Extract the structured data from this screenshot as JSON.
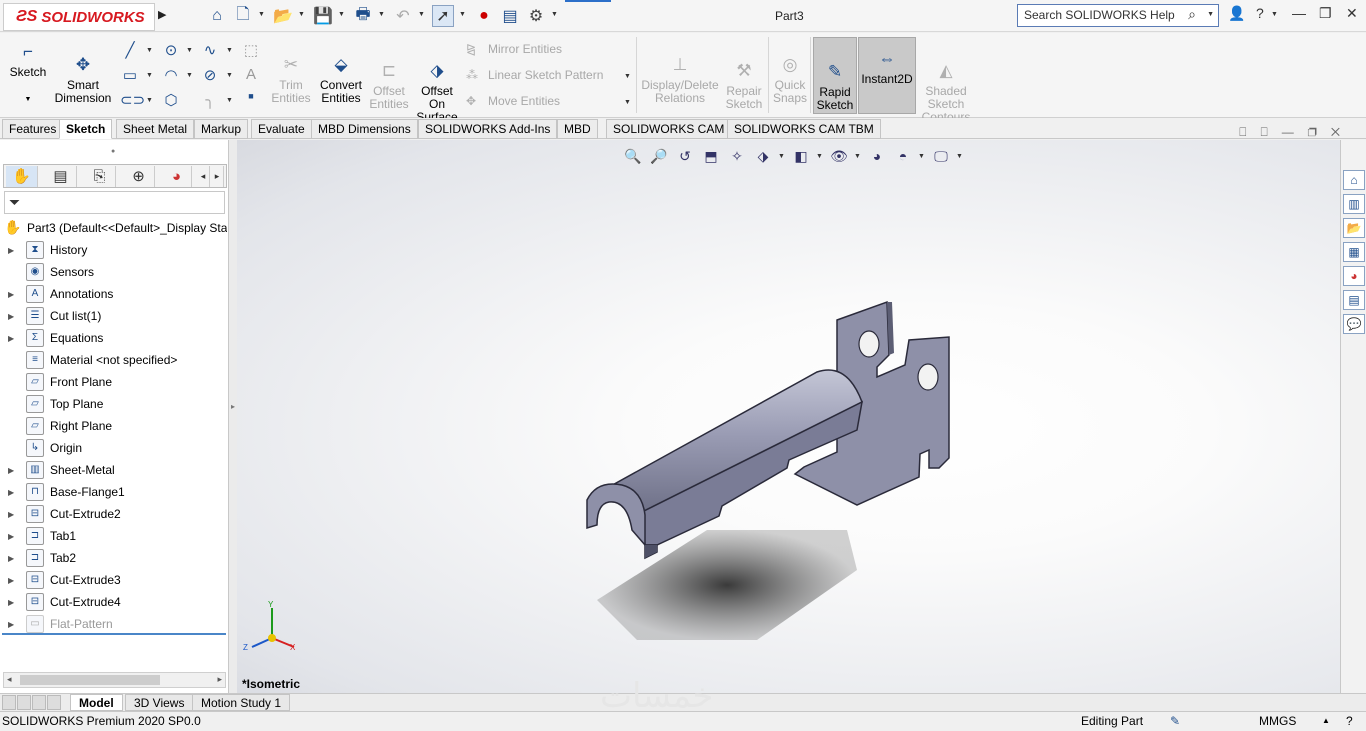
{
  "app": {
    "brand": "SOLIDWORKS",
    "document_title": "Part3",
    "search_placeholder": "Search SOLIDWORKS Help"
  },
  "quick_access": [
    {
      "name": "home-icon"
    },
    {
      "name": "new-document-icon"
    },
    {
      "name": "open-icon"
    },
    {
      "name": "save-icon"
    },
    {
      "name": "print-icon"
    },
    {
      "name": "undo-icon"
    },
    {
      "name": "select-cursor-icon"
    },
    {
      "name": "rebuild-traffic-light-icon"
    },
    {
      "name": "file-properties-icon"
    },
    {
      "name": "options-gear-icon"
    }
  ],
  "ribbon": {
    "sketch": "Sketch",
    "smart_dimension": "Smart\nDimension",
    "trim_entities": "Trim\nEntities",
    "convert_entities": "Convert\nEntities",
    "offset_entities": "Offset\nEntities",
    "offset_on_surface": "Offset\nOn\nSurface",
    "mirror_entities": "Mirror Entities",
    "linear_sketch_pattern": "Linear Sketch Pattern",
    "move_entities": "Move Entities",
    "display_delete_relations": "Display/Delete\nRelations",
    "repair_sketch": "Repair\nSketch",
    "quick_snaps": "Quick\nSnaps",
    "rapid_sketch": "Rapid\nSketch",
    "instant2d": "Instant2D",
    "shaded_sketch_contours": "Shaded\nSketch\nContours"
  },
  "command_tabs": [
    {
      "label": "Features",
      "selected": false
    },
    {
      "label": "Sketch",
      "selected": true
    },
    {
      "label": "Sheet Metal",
      "selected": false
    },
    {
      "label": "Markup",
      "selected": false
    },
    {
      "label": "Evaluate",
      "selected": false
    },
    {
      "label": "MBD Dimensions",
      "selected": false
    },
    {
      "label": "SOLIDWORKS Add-Ins",
      "selected": false
    },
    {
      "label": "MBD",
      "selected": false
    },
    {
      "label": "SOLIDWORKS CAM",
      "selected": false
    },
    {
      "label": "SOLIDWORKS CAM TBM",
      "selected": false
    }
  ],
  "feature_tree": {
    "root": "Part3  (Default<<Default>_Display State 1>)",
    "items": [
      {
        "label": "History",
        "icon": "history-folder-icon",
        "expandable": true
      },
      {
        "label": "Sensors",
        "icon": "sensors-icon",
        "expandable": false
      },
      {
        "label": "Annotations",
        "icon": "annotations-icon",
        "expandable": true
      },
      {
        "label": "Cut list(1)",
        "icon": "cut-list-icon",
        "expandable": true
      },
      {
        "label": "Equations",
        "icon": "equations-icon",
        "expandable": true
      },
      {
        "label": "Material <not specified>",
        "icon": "material-icon",
        "expandable": false
      },
      {
        "label": "Front Plane",
        "icon": "plane-icon",
        "expandable": false
      },
      {
        "label": "Top Plane",
        "icon": "plane-icon",
        "expandable": false
      },
      {
        "label": "Right Plane",
        "icon": "plane-icon",
        "expandable": false
      },
      {
        "label": "Origin",
        "icon": "origin-icon",
        "expandable": false
      },
      {
        "label": "Sheet-Metal",
        "icon": "sheet-metal-icon",
        "expandable": true
      },
      {
        "label": "Base-Flange1",
        "icon": "base-flange-icon",
        "expandable": true
      },
      {
        "label": "Cut-Extrude2",
        "icon": "cut-extrude-icon",
        "expandable": true
      },
      {
        "label": "Tab1",
        "icon": "tab-feature-icon",
        "expandable": true
      },
      {
        "label": "Tab2",
        "icon": "tab-feature-icon",
        "expandable": true
      },
      {
        "label": "Cut-Extrude3",
        "icon": "cut-extrude-icon",
        "expandable": true
      },
      {
        "label": "Cut-Extrude4",
        "icon": "cut-extrude-icon",
        "expandable": true
      },
      {
        "label": "Flat-Pattern",
        "icon": "flat-pattern-icon",
        "expandable": true,
        "suppressed": true
      }
    ]
  },
  "viewport": {
    "view_label": "*Isometric",
    "triad": {
      "x": "X",
      "y": "Y",
      "z": "Z"
    }
  },
  "bottom_tabs": [
    {
      "label": "Model",
      "selected": true
    },
    {
      "label": "3D Views",
      "selected": false
    },
    {
      "label": "Motion Study 1",
      "selected": false
    }
  ],
  "status": {
    "version": "SOLIDWORKS Premium 2020 SP0.0",
    "mode": "Editing Part",
    "units": "MMGS"
  },
  "watermark": "خمسات",
  "colors": {
    "brand_red": "#d71920",
    "accent_blue": "#1f4e8c",
    "part_face": "#8e90a8"
  }
}
